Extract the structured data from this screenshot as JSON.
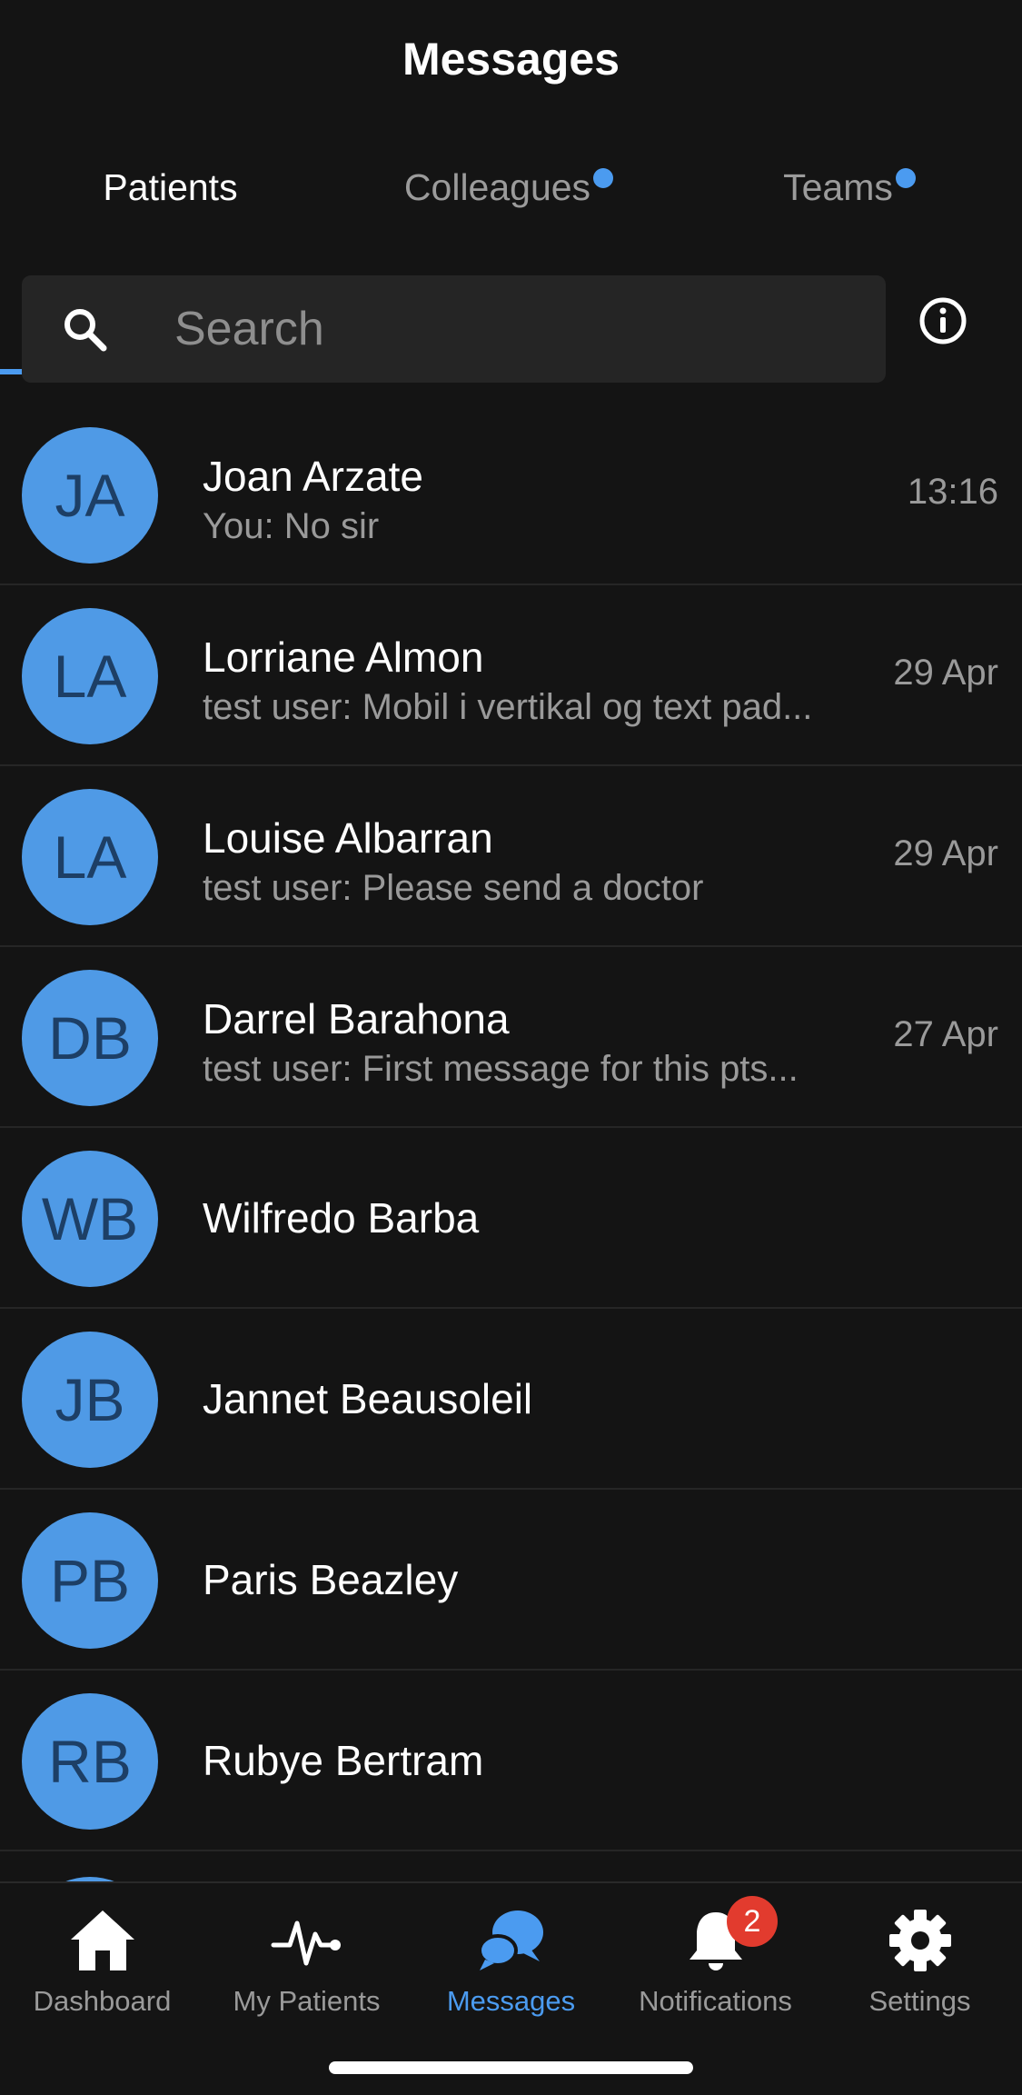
{
  "header": {
    "title": "Messages"
  },
  "tabs": [
    {
      "label": "Patients",
      "active": true,
      "unread_dot": false
    },
    {
      "label": "Colleagues",
      "active": false,
      "unread_dot": true
    },
    {
      "label": "Teams",
      "active": false,
      "unread_dot": true
    }
  ],
  "search": {
    "placeholder": "Search",
    "value": ""
  },
  "conversations": [
    {
      "initials": "JA",
      "name": "Joan Arzate",
      "preview": "You: No sir",
      "time": "13:16"
    },
    {
      "initials": "LA",
      "name": "Lorriane Almon",
      "preview": "test user: Mobil i vertikal og text pad...",
      "time": "29 Apr"
    },
    {
      "initials": "LA",
      "name": "Louise Albarran",
      "preview": "test user: Please send a doctor",
      "time": "29 Apr"
    },
    {
      "initials": "DB",
      "name": "Darrel Barahona",
      "preview": "test user: First message for this pts...",
      "time": "27 Apr"
    },
    {
      "initials": "WB",
      "name": "Wilfredo Barba",
      "preview": "",
      "time": ""
    },
    {
      "initials": "JB",
      "name": "Jannet Beausoleil",
      "preview": "",
      "time": ""
    },
    {
      "initials": "PB",
      "name": "Paris Beazley",
      "preview": "",
      "time": ""
    },
    {
      "initials": "RB",
      "name": "Rubye Bertram",
      "preview": "",
      "time": ""
    }
  ],
  "bottom_nav": [
    {
      "label": "Dashboard",
      "icon": "home-icon",
      "active": false
    },
    {
      "label": "My Patients",
      "icon": "pulse-icon",
      "active": false
    },
    {
      "label": "Messages",
      "icon": "chat-bubbles-icon",
      "active": true
    },
    {
      "label": "Notifications",
      "icon": "bell-icon",
      "active": false,
      "badge": "2"
    },
    {
      "label": "Settings",
      "icon": "gear-icon",
      "active": false
    }
  ],
  "colors": {
    "background": "#141414",
    "accent": "#4b9bf0",
    "avatar": "#4f9ae6",
    "avatar_text": "#1d3f66",
    "badge": "#e23b2e"
  }
}
